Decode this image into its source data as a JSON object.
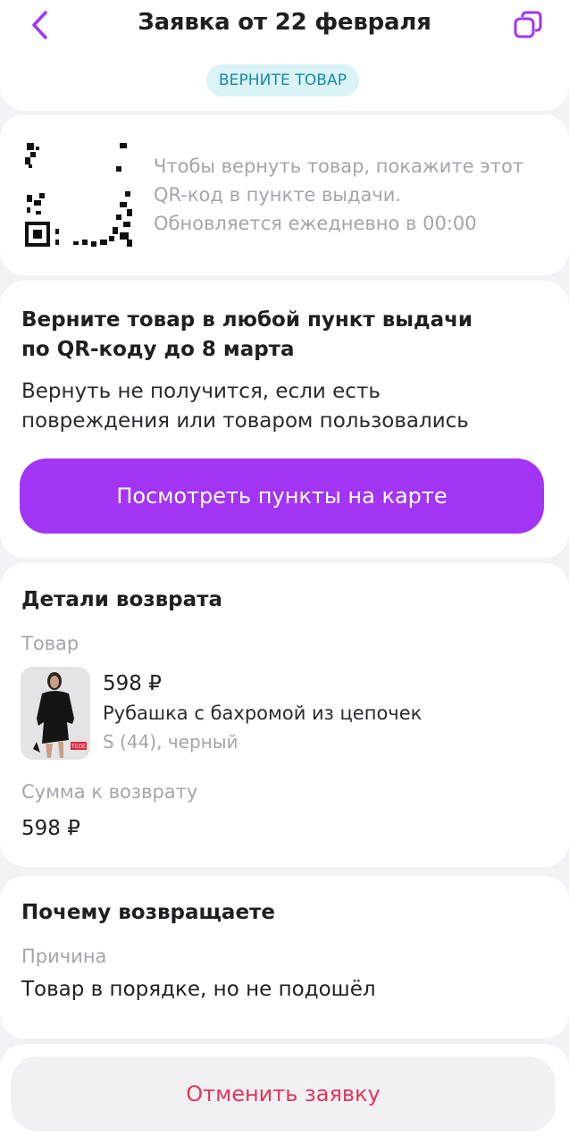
{
  "header": {
    "title": "Заявка от 22 февраля",
    "back_icon": "chevron-left-icon",
    "copy_icon": "copy-icon",
    "status_badge": "ВЕРНИТЕ ТОВАР"
  },
  "qr": {
    "instruction_line1": "Чтобы вернуть товар, покажите этот",
    "instruction_line2": "QR-код в пункте выдачи.",
    "instruction_line3": "Обновляется ежедневно в 00:00"
  },
  "return_info": {
    "title_line1": "Верните товар в любой пункт выдачи",
    "title_line2": "по QR-коду до 8 марта",
    "desc_line1": "Вернуть не получится, если есть",
    "desc_line2": "повреждения или товаром пользовались",
    "map_button": "Посмотреть пункты на карте"
  },
  "details": {
    "title": "Детали возврата",
    "product_label": "Товар",
    "product": {
      "price": "598 ₽",
      "name": "Рубашка с бахромой из цепочек",
      "variant": "S (44), черный",
      "thumb_tag": "TEOE"
    },
    "refund_label": "Сумма к возврату",
    "refund_value": "598 ₽"
  },
  "reason": {
    "title": "Почему возвращаете",
    "label": "Причина",
    "value": "Товар в порядке, но не подошёл"
  },
  "footer": {
    "cancel_button": "Отменить заявку"
  },
  "colors": {
    "accent": "#a235f4",
    "badge_bg": "#d9f3f7",
    "badge_text": "#1a8aa0",
    "danger": "#e2365a",
    "muted": "#a4a4ab"
  }
}
